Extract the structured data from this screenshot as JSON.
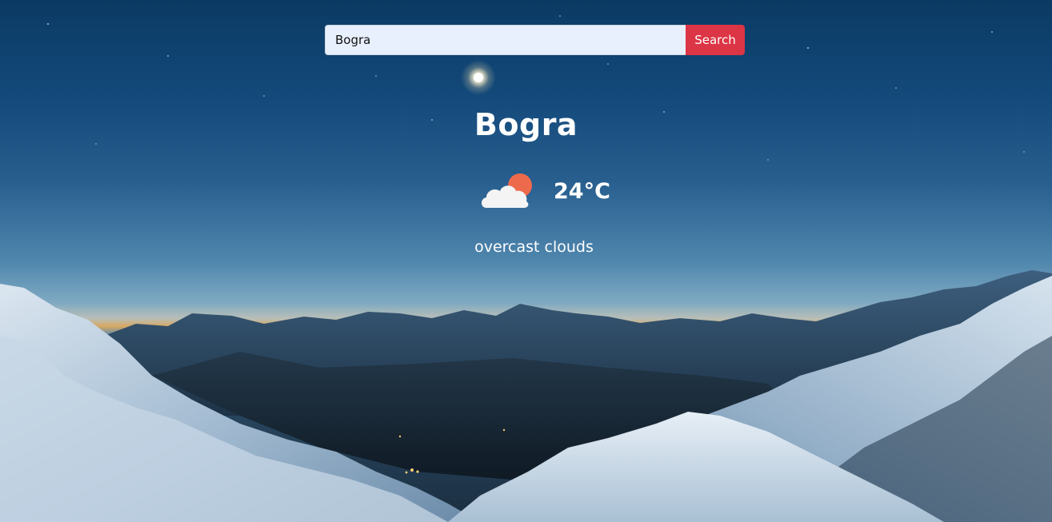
{
  "search": {
    "value": "Bogra",
    "button_label": "Search"
  },
  "weather": {
    "city": "Bogra",
    "temperature": "24°C",
    "description": "overcast clouds",
    "icon": "cloud-sun-icon"
  },
  "colors": {
    "search_button": "#dc3545",
    "input_background": "#e8f0fe",
    "text": "#ffffff",
    "sun": "#ee6a4c",
    "cloud": "#f4f4f4"
  }
}
